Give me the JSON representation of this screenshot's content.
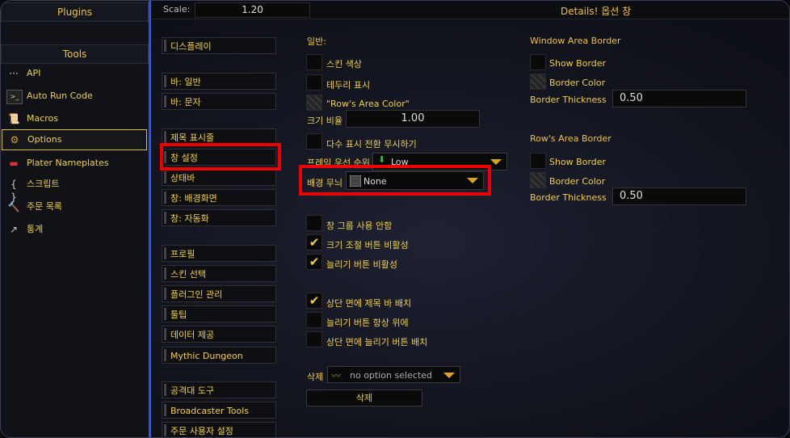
{
  "top": {
    "scale_label": "Scale:",
    "scale_value": "1.20",
    "title": "Details! 옵션 창"
  },
  "sidebar": {
    "plugins_header": "Plugins",
    "tools_header": "Tools",
    "items": [
      {
        "label": "API",
        "icon": "dots-icon"
      },
      {
        "label": "Auto Run Code",
        "icon": "terminal-icon"
      },
      {
        "label": "Macros",
        "icon": "scroll-icon"
      },
      {
        "label": "Options",
        "icon": "gear-icon",
        "active": true
      },
      {
        "label": "Plater Nameplates",
        "icon": "nameplate-icon"
      },
      {
        "label": "스크립트",
        "icon": "braces-icon"
      },
      {
        "label": "주문 목록",
        "icon": "hammer-icon"
      },
      {
        "label": "통계",
        "icon": "chart-icon"
      }
    ]
  },
  "menu": {
    "items": [
      "디스플레이",
      "바: 일반",
      "바: 문자",
      "제목 표시줄",
      "창 설정",
      "상태바",
      "창: 배경화면",
      "창: 자동화",
      "프로필",
      "스킨 선택",
      "플러그인 관리",
      "툴팁",
      "데이터 제공",
      "Mythic Dungeon",
      "공격대 도구",
      "Broadcaster Tools",
      "주문 사용자 설정"
    ]
  },
  "general": {
    "header": "일반:",
    "skin_color": "스킨 색상",
    "border_show": "테두리 표시",
    "rows_area_color": "\"Row's Area Color\"",
    "size_ratio_label": "크기 비율",
    "size_ratio_value": "1.00",
    "ignore_mass_toggle": "다수 표시 전환 무시하기",
    "frame_strata_label": "프레임 우선 순위",
    "frame_strata_value": "Low",
    "bg_texture_label": "배경 무늬",
    "bg_texture_value": "None",
    "no_window_group": "창 그룹 사용 안함",
    "resize_btn_disable": "크기 조절 버튼 비활성",
    "stretch_btn_disable": "늘리기 버튼 비활성",
    "title_bar_top": "상단 면에 제목 바 배치",
    "stretch_always_top": "늘리기 버튼 항상 위에",
    "stretch_btn_top": "상단 면에 늘리기 버튼 배치",
    "delete_label": "삭제",
    "delete_select": "no option selected",
    "delete_button": "삭제"
  },
  "window_border": {
    "header": "Window Area Border",
    "show_border": "Show Border",
    "border_color": "Border Color",
    "thickness_label": "Border Thickness",
    "thickness_value": "0.50"
  },
  "row_border": {
    "header": "Row's Area Border",
    "show_border": "Show Border",
    "border_color": "Border Color",
    "thickness_label": "Border Thickness",
    "thickness_value": "0.50"
  },
  "colors": {
    "accent": "#f2c23a",
    "highlight": "#ee0000",
    "divider": "#3b56b8"
  }
}
